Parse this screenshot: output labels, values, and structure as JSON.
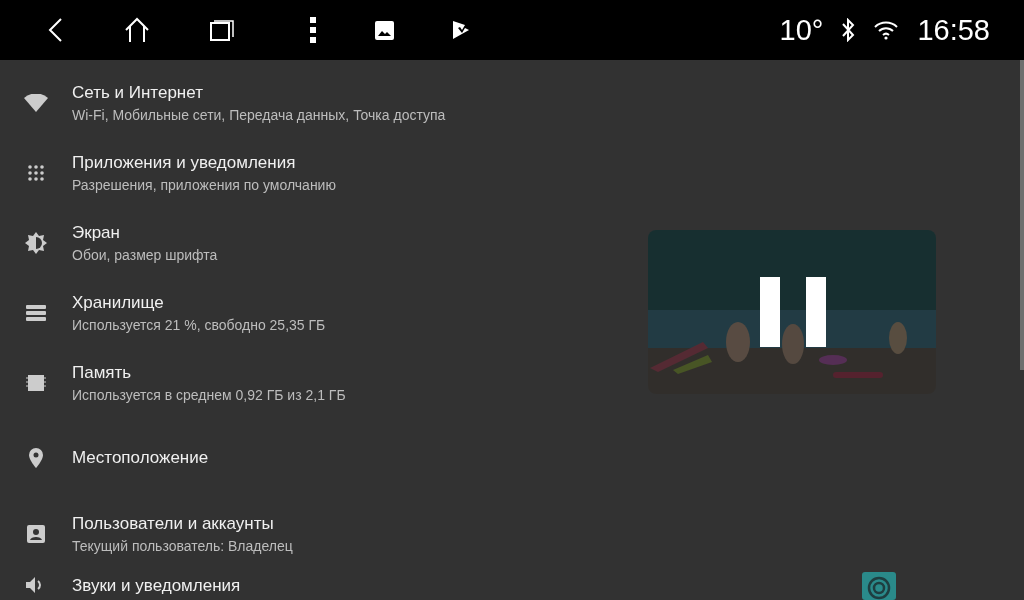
{
  "status_bar": {
    "temperature": "10°",
    "time": "16:58"
  },
  "settings": [
    {
      "title": "Сеть и Интернет",
      "subtitle": "Wi-Fi, Мобильные сети, Передача данных, Точка доступа"
    },
    {
      "title": "Приложения и уведомления",
      "subtitle": "Разрешения, приложения по умолчанию"
    },
    {
      "title": "Экран",
      "subtitle": "Обои, размер шрифта"
    },
    {
      "title": "Хранилище",
      "subtitle": "Используется 21 %, свободно 25,35 ГБ"
    },
    {
      "title": "Память",
      "subtitle": "Используется в среднем 0,92 ГБ из 2,1 ГБ"
    },
    {
      "title": "Местоположение"
    },
    {
      "title": "Пользователи и аккаунты",
      "subtitle": "Текущий пользователь: Владелец"
    },
    {
      "title": "Звуки и уведомления"
    }
  ],
  "video_overlay": {
    "kind": "picture",
    "paused": true
  }
}
